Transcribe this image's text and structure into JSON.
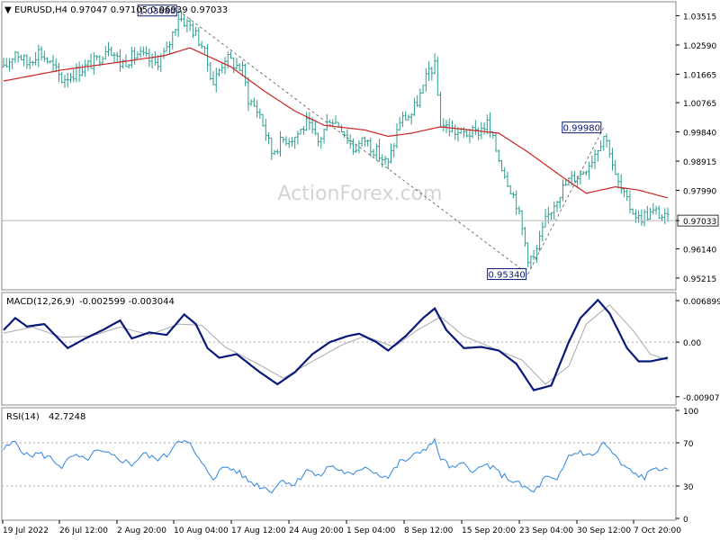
{
  "main_header": "EURUSD,H4  0.97047 0.97105 0.96939 0.97033",
  "watermark": "ActionForex.com",
  "colors": {
    "price": "#2a9d8f",
    "sma": "#cc2222",
    "macd": "#0a1a7a",
    "signal": "#a9a9a9",
    "rsi": "#2e86de",
    "grid_dash": "#aaaaaa",
    "frame": "#888888"
  },
  "chart_data": [
    {
      "type": "bar",
      "title": "EURUSD,H4",
      "ohlc_text": "0.97047 0.97105 0.96939 0.97033",
      "ylim": [
        0.949,
        1.039
      ],
      "y_ticks": [
        "1.03515",
        "1.02590",
        "1.01665",
        "1.00765",
        "0.99840",
        "0.98915",
        "0.97990",
        "0.97033",
        "0.96140",
        "0.95215"
      ],
      "current_price": "0.97033",
      "x_ticks": [
        "19 Jul 2022",
        "26 Jul 12:00",
        "2 Aug 20:00",
        "10 Aug 04:00",
        "17 Aug 12:00",
        "24 Aug 20:00",
        "1 Sep 04:00",
        "8 Sep 12:00",
        "15 Sep 20:00",
        "23 Sep 04:00",
        "30 Sep 12:00",
        "7 Oct 20:00"
      ],
      "annotations": [
        {
          "label": "1.03680",
          "index": 60,
          "value": 1.0368
        },
        {
          "label": "0.95340",
          "index": 180,
          "value": 0.9534
        },
        {
          "label": "0.99980",
          "index": 206,
          "value": 0.9998
        }
      ],
      "trend_lines": [
        {
          "from": {
            "index": 60,
            "value": 1.0368
          },
          "to": {
            "index": 180,
            "value": 0.9534
          }
        },
        {
          "from": {
            "index": 180,
            "value": 0.9534
          },
          "to": {
            "index": 206,
            "value": 0.9998
          }
        }
      ],
      "close_keypoints": [
        [
          0,
          1.018
        ],
        [
          4,
          1.024
        ],
        [
          8,
          1.02
        ],
        [
          12,
          1.024
        ],
        [
          16,
          1.02
        ],
        [
          20,
          1.015
        ],
        [
          26,
          1.018
        ],
        [
          32,
          1.021
        ],
        [
          36,
          1.026
        ],
        [
          40,
          1.02
        ],
        [
          46,
          1.023
        ],
        [
          52,
          1.02
        ],
        [
          56,
          1.024
        ],
        [
          60,
          1.035
        ],
        [
          64,
          1.032
        ],
        [
          68,
          1.026
        ],
        [
          72,
          1.014
        ],
        [
          76,
          1.022
        ],
        [
          82,
          1.018
        ],
        [
          84,
          1.009
        ],
        [
          88,
          1.004
        ],
        [
          92,
          0.992
        ],
        [
          96,
          0.996
        ],
        [
          100,
          0.997
        ],
        [
          104,
          1.001
        ],
        [
          108,
          0.995
        ],
        [
          112,
          1.003
        ],
        [
          116,
          1.0
        ],
        [
          120,
          0.993
        ],
        [
          124,
          0.996
        ],
        [
          128,
          0.992
        ],
        [
          132,
          0.988
        ],
        [
          136,
          1.002
        ],
        [
          140,
          1.004
        ],
        [
          144,
          1.012
        ],
        [
          146,
          1.018
        ],
        [
          148,
          1.019
        ],
        [
          150,
          1.001
        ],
        [
          156,
          0.998
        ],
        [
          162,
          0.998
        ],
        [
          166,
          1.001
        ],
        [
          170,
          0.99
        ],
        [
          176,
          0.976
        ],
        [
          180,
          0.959
        ],
        [
          182,
          0.958
        ],
        [
          186,
          0.97
        ],
        [
          190,
          0.978
        ],
        [
          194,
          0.983
        ],
        [
          198,
          0.985
        ],
        [
          202,
          0.99
        ],
        [
          206,
          0.9975
        ],
        [
          208,
          0.993
        ],
        [
          210,
          0.984
        ],
        [
          214,
          0.976
        ],
        [
          218,
          0.971
        ],
        [
          220,
          0.972
        ],
        [
          224,
          0.973
        ],
        [
          228,
          0.9703
        ]
      ],
      "sma_keypoints": [
        [
          0,
          1.0145
        ],
        [
          20,
          1.018
        ],
        [
          40,
          1.0205
        ],
        [
          55,
          1.0225
        ],
        [
          64,
          1.025
        ],
        [
          78,
          1.019
        ],
        [
          90,
          1.011
        ],
        [
          100,
          1.005
        ],
        [
          110,
          1.0005
        ],
        [
          124,
          0.999
        ],
        [
          132,
          0.997
        ],
        [
          140,
          0.998
        ],
        [
          150,
          1.0
        ],
        [
          160,
          0.999
        ],
        [
          170,
          0.998
        ],
        [
          180,
          0.992
        ],
        [
          192,
          0.984
        ],
        [
          200,
          0.979
        ],
        [
          210,
          0.981
        ],
        [
          218,
          0.98
        ],
        [
          228,
          0.9775
        ]
      ],
      "bar_count": 229
    },
    {
      "type": "line",
      "title": "MACD(12,26,9)",
      "values_text": "-0.002599 -0.003044",
      "ylim": [
        -0.01,
        0.0078
      ],
      "y_ticks": [
        "0.006899",
        "0.00",
        "-0.009076"
      ],
      "zero_line": 0,
      "macd_keypoints": [
        [
          0,
          0.002
        ],
        [
          4,
          0.004
        ],
        [
          8,
          0.0026
        ],
        [
          14,
          0.003
        ],
        [
          18,
          0.001
        ],
        [
          22,
          -0.001
        ],
        [
          28,
          0.0006
        ],
        [
          34,
          0.002
        ],
        [
          40,
          0.0036
        ],
        [
          44,
          0.0006
        ],
        [
          50,
          0.0016
        ],
        [
          56,
          0.0012
        ],
        [
          62,
          0.0046
        ],
        [
          66,
          0.003
        ],
        [
          70,
          -0.001
        ],
        [
          74,
          -0.0026
        ],
        [
          80,
          -0.002
        ],
        [
          88,
          -0.005
        ],
        [
          94,
          -0.007
        ],
        [
          100,
          -0.005
        ],
        [
          106,
          -0.002
        ],
        [
          112,
          0.0
        ],
        [
          118,
          0.001
        ],
        [
          122,
          0.0014
        ],
        [
          128,
          0.0
        ],
        [
          132,
          -0.0014
        ],
        [
          138,
          0.001
        ],
        [
          144,
          0.004
        ],
        [
          148,
          0.0056
        ],
        [
          152,
          0.002
        ],
        [
          158,
          -0.001
        ],
        [
          164,
          -0.0008
        ],
        [
          170,
          -0.0014
        ],
        [
          176,
          -0.0036
        ],
        [
          182,
          -0.008
        ],
        [
          188,
          -0.0072
        ],
        [
          194,
          0.0
        ],
        [
          198,
          0.004
        ],
        [
          204,
          0.007
        ],
        [
          208,
          0.0048
        ],
        [
          214,
          -0.001
        ],
        [
          218,
          -0.0032
        ],
        [
          222,
          -0.0032
        ],
        [
          228,
          -0.0026
        ]
      ],
      "signal_keypoints": [
        [
          0,
          0.0015
        ],
        [
          10,
          0.0025
        ],
        [
          20,
          0.0008
        ],
        [
          30,
          0.001
        ],
        [
          40,
          0.0025
        ],
        [
          50,
          0.0012
        ],
        [
          60,
          0.003
        ],
        [
          68,
          0.0028
        ],
        [
          76,
          -0.0008
        ],
        [
          88,
          -0.0038
        ],
        [
          96,
          -0.006
        ],
        [
          106,
          -0.0032
        ],
        [
          116,
          -0.0005
        ],
        [
          124,
          0.001
        ],
        [
          134,
          -0.0008
        ],
        [
          142,
          0.002
        ],
        [
          150,
          0.0042
        ],
        [
          158,
          0.001
        ],
        [
          168,
          -0.001
        ],
        [
          178,
          -0.003
        ],
        [
          186,
          -0.007
        ],
        [
          194,
          -0.004
        ],
        [
          200,
          0.003
        ],
        [
          208,
          0.0062
        ],
        [
          216,
          0.002
        ],
        [
          222,
          -0.002
        ],
        [
          228,
          -0.003
        ]
      ]
    },
    {
      "type": "line",
      "title": "RSI(14)",
      "value_text": "42.7248",
      "ylim": [
        0,
        100
      ],
      "y_ticks": [
        "100",
        "70",
        "30",
        "0"
      ],
      "levels": [
        70,
        30
      ],
      "keypoints": [
        [
          0,
          64
        ],
        [
          4,
          71
        ],
        [
          8,
          58
        ],
        [
          12,
          60
        ],
        [
          16,
          56
        ],
        [
          20,
          48
        ],
        [
          24,
          58
        ],
        [
          28,
          54
        ],
        [
          32,
          62
        ],
        [
          36,
          59
        ],
        [
          40,
          55
        ],
        [
          44,
          50
        ],
        [
          48,
          60
        ],
        [
          52,
          55
        ],
        [
          56,
          58
        ],
        [
          60,
          74
        ],
        [
          64,
          68
        ],
        [
          68,
          50
        ],
        [
          72,
          38
        ],
        [
          76,
          48
        ],
        [
          80,
          44
        ],
        [
          84,
          35
        ],
        [
          88,
          30
        ],
        [
          92,
          26
        ],
        [
          96,
          36
        ],
        [
          100,
          31
        ],
        [
          104,
          46
        ],
        [
          108,
          38
        ],
        [
          112,
          49
        ],
        [
          116,
          44
        ],
        [
          120,
          39
        ],
        [
          124,
          49
        ],
        [
          128,
          42
        ],
        [
          132,
          38
        ],
        [
          136,
          52
        ],
        [
          140,
          56
        ],
        [
          144,
          64
        ],
        [
          148,
          71
        ],
        [
          150,
          56
        ],
        [
          154,
          46
        ],
        [
          158,
          50
        ],
        [
          162,
          44
        ],
        [
          166,
          50
        ],
        [
          170,
          42
        ],
        [
          174,
          36
        ],
        [
          178,
          30
        ],
        [
          182,
          24
        ],
        [
          186,
          38
        ],
        [
          190,
          34
        ],
        [
          194,
          58
        ],
        [
          198,
          62
        ],
        [
          202,
          57
        ],
        [
          206,
          70
        ],
        [
          208,
          64
        ],
        [
          212,
          50
        ],
        [
          216,
          42
        ],
        [
          220,
          38
        ],
        [
          224,
          48
        ],
        [
          228,
          43
        ]
      ]
    }
  ]
}
